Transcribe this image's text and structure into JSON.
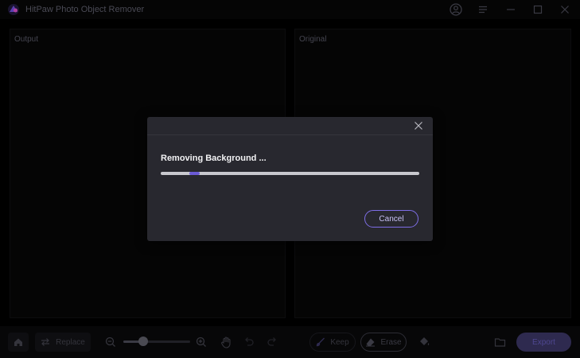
{
  "window": {
    "title": "HitPaw Photo Object Remover"
  },
  "titlebar": {
    "icons": [
      "account-icon",
      "menu-icon",
      "minimize-icon",
      "maximize-icon",
      "close-icon"
    ]
  },
  "panels": {
    "output_label": "Output",
    "original_label": "Original"
  },
  "toolbar": {
    "replace_label": "Replace",
    "keep_label": "Keep",
    "erase_label": "Erase",
    "export_label": "Export",
    "zoom_level": 0.3
  },
  "dialog": {
    "title": "Removing Background ...",
    "cancel_label": "Cancel",
    "progress": {
      "indeterminate": true,
      "segment_start": 0.11,
      "segment_end": 0.15
    }
  },
  "colors": {
    "accent": "#6b5bd6",
    "accent_border": "#7e6ee6",
    "dialog_bg": "#28282f",
    "export_bg": "#2e2a4f",
    "background": "#000000"
  }
}
